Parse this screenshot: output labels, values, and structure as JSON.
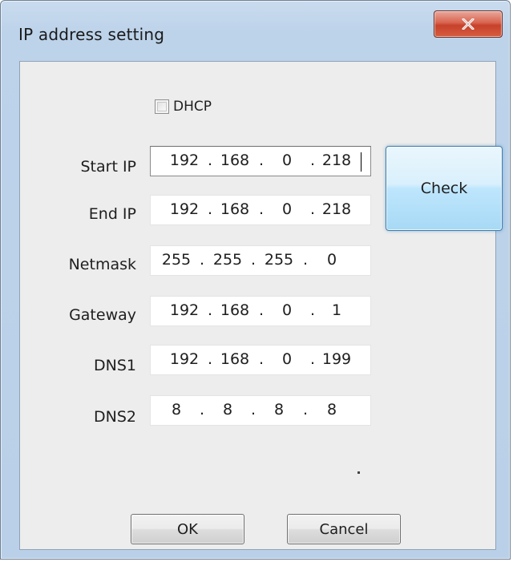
{
  "window": {
    "title": "IP address setting"
  },
  "dhcp": {
    "label": "DHCP",
    "checked": false
  },
  "fields": [
    {
      "label": "Start IP",
      "octets": [
        "192",
        "168",
        "0",
        "218"
      ]
    },
    {
      "label": "End IP",
      "octets": [
        "192",
        "168",
        "0",
        "218"
      ]
    },
    {
      "label": "Netmask",
      "octets": [
        "255",
        "255",
        "255",
        "0"
      ]
    },
    {
      "label": "Gateway",
      "octets": [
        "192",
        "168",
        "0",
        "1"
      ]
    },
    {
      "label": "DNS1",
      "octets": [
        "192",
        "168",
        "0",
        "199"
      ]
    },
    {
      "label": "DNS2",
      "octets": [
        "8",
        "8",
        "8",
        "8"
      ]
    }
  ],
  "buttons": {
    "check": "Check",
    "ok": "OK",
    "cancel": "Cancel"
  },
  "icons": {
    "close": "close-icon"
  },
  "colors": {
    "frame": "#bdd3ea",
    "client": "#ededed",
    "close_button": "#c7412a",
    "check_button": "#bee6fd"
  }
}
